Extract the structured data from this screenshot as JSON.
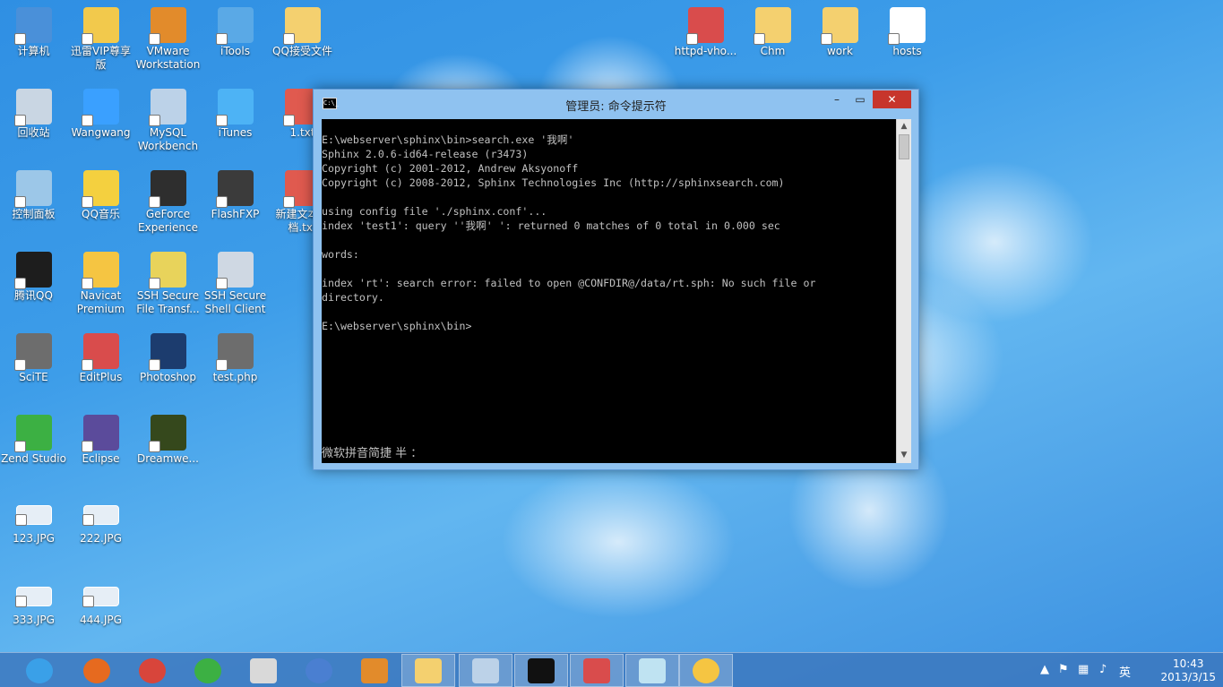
{
  "desktop": {
    "icons": [
      {
        "label": "计算机",
        "icon": "computer-icon",
        "color": "#4a90d9"
      },
      {
        "label": "迅雷VIP尊享版",
        "icon": "thunder-icon",
        "color": "#f2c94c"
      },
      {
        "label": "VMware Workstation",
        "icon": "vmware-icon",
        "color": "#e28b2b"
      },
      {
        "label": "iTools",
        "icon": "itools-icon",
        "color": "#5aa9e6"
      },
      {
        "label": "QQ接受文件",
        "icon": "folder-icon",
        "color": "#f4d06f"
      },
      {
        "label": "回收站",
        "icon": "recycle-bin-icon",
        "color": "#c9d6e3"
      },
      {
        "label": "Wangwang",
        "icon": "wangwang-icon",
        "color": "#3aa0ff"
      },
      {
        "label": "MySQL Workbench",
        "icon": "mysql-icon",
        "color": "#bcd2e8"
      },
      {
        "label": "iTunes",
        "icon": "itunes-icon",
        "color": "#4db3f5"
      },
      {
        "label": "1.txt",
        "icon": "text-file-icon",
        "color": "#e05a4f"
      },
      {
        "label": "控制面板",
        "icon": "control-panel-icon",
        "color": "#9cc7e8"
      },
      {
        "label": "QQ音乐",
        "icon": "qq-music-icon",
        "color": "#f4d03f"
      },
      {
        "label": "GeForce Experience",
        "icon": "geforce-icon",
        "color": "#2e2e2e"
      },
      {
        "label": "FlashFXP",
        "icon": "flashfxp-icon",
        "color": "#3b3b3b"
      },
      {
        "label": "新建文本文档.txt",
        "icon": "text-file-icon",
        "color": "#e05a4f"
      },
      {
        "label": "腾讯QQ",
        "icon": "qq-icon",
        "color": "#1d1d1d"
      },
      {
        "label": "Navicat Premium",
        "icon": "navicat-icon",
        "color": "#f5c542"
      },
      {
        "label": "SSH Secure File Transf...",
        "icon": "ssh-file-icon",
        "color": "#e8d35b"
      },
      {
        "label": "SSH Secure Shell Client",
        "icon": "ssh-shell-icon",
        "color": "#cfd8e3"
      },
      {
        "label": "SciTE",
        "icon": "scite-icon",
        "color": "#6d6d6d"
      },
      {
        "label": "EditPlus",
        "icon": "editplus-icon",
        "color": "#d94c4c"
      },
      {
        "label": "Photoshop",
        "icon": "photoshop-icon",
        "color": "#1c3c6e"
      },
      {
        "label": "test.php",
        "icon": "php-file-icon",
        "color": "#6d6d6d"
      },
      {
        "label": "Zend Studio",
        "icon": "zend-icon",
        "color": "#3cb043"
      },
      {
        "label": "Eclipse",
        "icon": "eclipse-icon",
        "color": "#5b4b9b"
      },
      {
        "label": "Dreamwe...",
        "icon": "dreamweaver-icon",
        "color": "#35481c"
      },
      {
        "label": "123.JPG",
        "icon": "image-file-icon",
        "color": "#e6eef6"
      },
      {
        "label": "222.JPG",
        "icon": "image-file-icon",
        "color": "#e6eef6"
      },
      {
        "label": "333.JPG",
        "icon": "image-file-icon",
        "color": "#e6eef6"
      },
      {
        "label": "444.JPG",
        "icon": "image-file-icon",
        "color": "#e6eef6"
      },
      {
        "label": "httpd-vho...",
        "icon": "editplus-file-icon",
        "color": "#d94c4c"
      },
      {
        "label": "Chm",
        "icon": "folder-icon",
        "color": "#f4d06f"
      },
      {
        "label": "work",
        "icon": "folder-icon",
        "color": "#f4d06f"
      },
      {
        "label": "hosts",
        "icon": "file-icon",
        "color": "#ffffff"
      }
    ]
  },
  "window": {
    "title": "管理员: 命令提示符",
    "min_glyph": "–",
    "max_glyph": "▭",
    "close_glyph": "✕",
    "app_icon_text": "C:\\_",
    "console_lines": [
      "E:\\webserver\\sphinx\\bin>search.exe '我啊'",
      "Sphinx 2.0.6-id64-release (r3473)",
      "Copyright (c) 2001-2012, Andrew Aksyonoff",
      "Copyright (c) 2008-2012, Sphinx Technologies Inc (http://sphinxsearch.com)",
      "",
      "using config file './sphinx.conf'...",
      "index 'test1': query ''我啊' ': returned 0 matches of 0 total in 0.000 sec",
      "",
      "words:",
      "",
      "index 'rt': search error: failed to open @CONFDIR@/data/rt.sph: No such file or",
      "directory.",
      "",
      "E:\\webserver\\sphinx\\bin>"
    ],
    "ime_status": "微软拼音简捷 半 ："
  },
  "taskbar": {
    "items": [
      {
        "icon": "ie-icon",
        "color": "#3aa0e8"
      },
      {
        "icon": "firefox-icon",
        "color": "#e66a1f"
      },
      {
        "icon": "chrome-icon",
        "color": "#d8453b"
      },
      {
        "icon": "green-ball-icon",
        "color": "#3cb043"
      },
      {
        "icon": "scissors-tool-icon",
        "color": "#d9d9d9"
      },
      {
        "icon": "globe-icon",
        "color": "#4a7fd1"
      },
      {
        "icon": "vmware-icon",
        "color": "#e28b2b"
      },
      {
        "icon": "explorer-icon",
        "color": "#f4d06f"
      },
      {
        "icon": "remote-desktop-icon",
        "color": "#bcd2e8"
      },
      {
        "icon": "cmd-icon",
        "color": "#111111"
      },
      {
        "icon": "editplus-icon",
        "color": "#d94c4c"
      },
      {
        "icon": "notepad-icon",
        "color": "#bfe3f2"
      },
      {
        "icon": "navicat-icon",
        "color": "#f5c542"
      }
    ],
    "tray": {
      "show_hidden": "▲",
      "ime_label": "英",
      "time": "10:43",
      "date": "2013/3/15"
    }
  }
}
